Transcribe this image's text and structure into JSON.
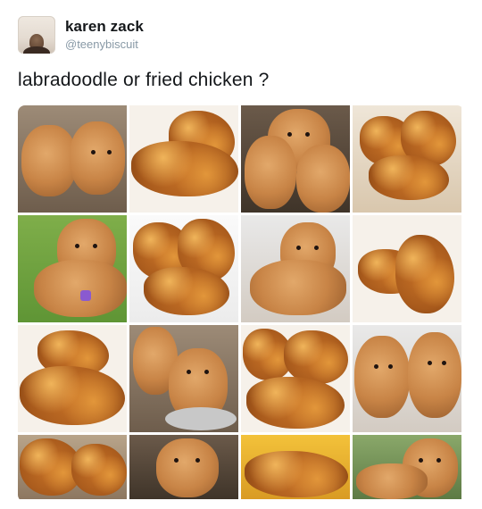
{
  "tweet": {
    "author_name": "karen zack",
    "author_handle": "@teenybiscuit",
    "text": "labradoodle or fried chicken ?"
  },
  "media": {
    "columns": 4,
    "tiles": [
      {
        "subject": "labradoodle",
        "icon": "dog-icon"
      },
      {
        "subject": "fried chicken",
        "icon": "chicken-icon"
      },
      {
        "subject": "labradoodle",
        "icon": "dog-icon"
      },
      {
        "subject": "fried chicken",
        "icon": "chicken-icon"
      },
      {
        "subject": "labradoodle",
        "icon": "dog-icon"
      },
      {
        "subject": "fried chicken",
        "icon": "chicken-icon"
      },
      {
        "subject": "labradoodle",
        "icon": "dog-icon"
      },
      {
        "subject": "fried chicken",
        "icon": "chicken-icon"
      },
      {
        "subject": "fried chicken",
        "icon": "chicken-icon"
      },
      {
        "subject": "labradoodle",
        "icon": "dog-icon"
      },
      {
        "subject": "fried chicken",
        "icon": "chicken-icon"
      },
      {
        "subject": "labradoodle",
        "icon": "dog-icon"
      },
      {
        "subject": "fried chicken",
        "icon": "chicken-icon"
      },
      {
        "subject": "labradoodle",
        "icon": "dog-icon"
      },
      {
        "subject": "fried chicken",
        "icon": "chicken-icon"
      },
      {
        "subject": "labradoodle",
        "icon": "dog-icon"
      }
    ]
  }
}
